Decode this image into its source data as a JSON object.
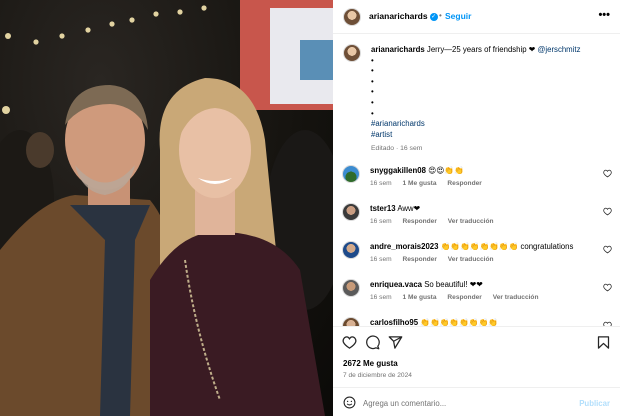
{
  "post": {
    "author": "arianarichards",
    "follow_label": "Seguir",
    "separator": "•",
    "more_label": "•••"
  },
  "caption": {
    "author": "arianarichards",
    "text": "Jerry—25 years of friendship ❤",
    "mention": "@jerschmitz",
    "bullets": [
      "•",
      "•",
      "•",
      "•",
      "•",
      "•"
    ],
    "hashtags": [
      "#arianarichards",
      "#artist"
    ],
    "meta": "Editado · 16 sem"
  },
  "comments": [
    {
      "user": "snyggakillen08",
      "text": "😍😍👏👏",
      "meta": [
        "16 sem",
        "1 Me gusta",
        "Responder"
      ]
    },
    {
      "user": "tster13",
      "text": "Aww❤",
      "meta": [
        "16 sem",
        "Responder",
        "Ver traducción"
      ]
    },
    {
      "user": "andre_morais2023",
      "text": "👏👏👏👏👏👏👏👏 congratulations",
      "meta": [
        "16 sem",
        "Responder",
        "Ver traducción"
      ]
    },
    {
      "user": "enriquea.vaca",
      "text": "So beautiful! ❤❤",
      "meta": [
        "16 sem",
        "1 Me gusta",
        "Responder",
        "Ver traducción"
      ]
    },
    {
      "user": "carlosfilho95",
      "text": "👏👏👏👏👏👏👏👏",
      "meta": []
    }
  ],
  "stats": {
    "likes": "2672 Me gusta",
    "date": "7 de diciembre de 2024"
  },
  "compose": {
    "placeholder": "Agrega un comentario...",
    "post_label": "Publicar"
  },
  "colors": {
    "accent": "#0095f6",
    "post_disabled": "#b2dffc",
    "link": "#00376b",
    "muted": "#737373"
  },
  "icons": [
    "verified-badge-icon",
    "more-options-icon",
    "heart-icon",
    "comment-icon",
    "share-icon",
    "bookmark-icon",
    "emoji-icon"
  ]
}
